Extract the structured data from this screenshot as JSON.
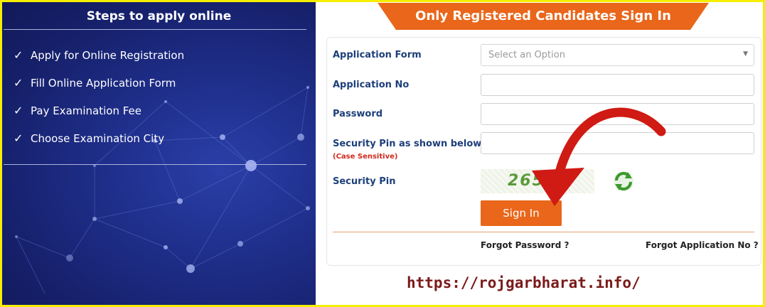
{
  "left_panel": {
    "title": "Steps to apply online",
    "steps": [
      {
        "check": "✓",
        "text": "Apply for Online Registration"
      },
      {
        "check": "✓",
        "text": "Fill Online Application Form"
      },
      {
        "check": "✓",
        "text": "Pay Examination Fee"
      },
      {
        "check": "✓",
        "text": "Choose Examination City"
      }
    ]
  },
  "sign_in": {
    "banner_title": "Only Registered Candidates Sign In",
    "application_form_label": "Application Form",
    "application_form_placeholder": "Select an Option",
    "application_no_label": "Application No",
    "password_label": "Password",
    "security_pin_input_label": "Security Pin as shown below",
    "case_note": "(Case Sensitive)",
    "security_pin_label": "Security Pin",
    "captcha_text": "265",
    "sign_in_button": "Sign In",
    "forgot_password": "Forgot Password ?",
    "forgot_application_no": "Forgot Application No ?"
  },
  "watermark": "https://rojgarbharat.info/",
  "colors": {
    "banner": "#e9661a",
    "button": "#e9661a",
    "label": "#1d3f7a",
    "arrow": "#d01a14",
    "panel": "#1f2f8c",
    "frame": "#f6ee00"
  },
  "icons": [
    "checkmark-icon",
    "dropdown-caret-icon",
    "refresh-icon",
    "red-arrow-annotation"
  ]
}
